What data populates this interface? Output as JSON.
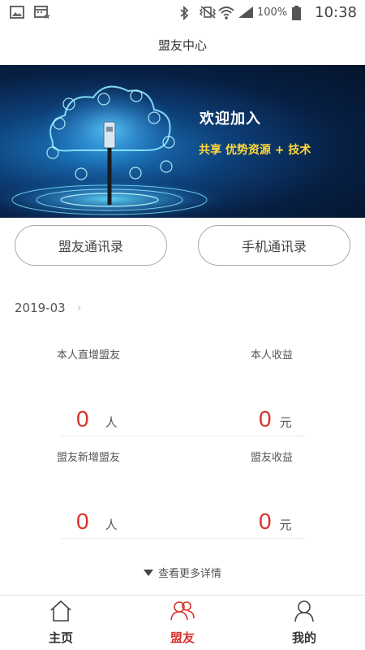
{
  "status_bar": {
    "battery": "100%",
    "time": "10:38",
    "icons": [
      "image-icon",
      "calendar-star-icon",
      "bluetooth-icon",
      "vibrate-icon",
      "wifi-icon",
      "signal-icon",
      "battery-icon"
    ]
  },
  "header": {
    "title": "盟友中心"
  },
  "banner": {
    "title": "欢迎加入",
    "subtitle": "共享 优势资源 + 技术"
  },
  "buttons": {
    "ally_contacts": "盟友通讯录",
    "phone_contacts": "手机通讯录"
  },
  "month": {
    "value": "2019-03"
  },
  "stats": {
    "self_new_allies": {
      "label": "本人直增盟友",
      "value": "0",
      "unit": "人"
    },
    "self_income": {
      "label": "本人收益",
      "value": "0",
      "unit": "元"
    },
    "ally_new_allies": {
      "label": "盟友新增盟友",
      "value": "0",
      "unit": "人"
    },
    "ally_income": {
      "label": "盟友收益",
      "value": "0",
      "unit": "元"
    }
  },
  "more": {
    "label": "查看更多详情"
  },
  "nav": {
    "items": [
      {
        "label": "主页",
        "icon": "home-icon"
      },
      {
        "label": "盟友",
        "icon": "allies-icon"
      },
      {
        "label": "我的",
        "icon": "profile-icon"
      }
    ],
    "active_index": 1
  },
  "colors": {
    "accent": "#d8322c",
    "banner_highlight": "#ffd83a"
  }
}
